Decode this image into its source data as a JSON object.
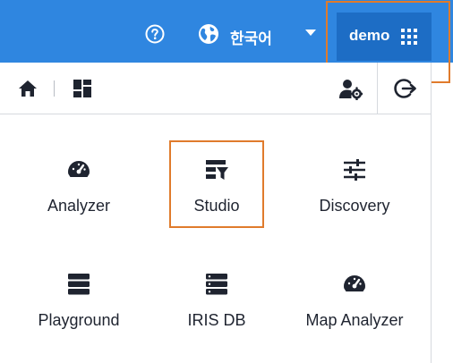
{
  "header": {
    "language_label": "한국어",
    "user_label": "demo",
    "help_icon": "question-circle-icon",
    "language_icon": "globe-icon",
    "apps_icon": "grid-apps-icon"
  },
  "toolbar": {
    "home_icon": "home-icon",
    "dashboard_icon": "dashboard-icon",
    "user_settings_icon": "user-cog-icon",
    "logout_icon": "logout-icon"
  },
  "apps": [
    {
      "label": "Analyzer",
      "icon": "speedometer-icon"
    },
    {
      "label": "Studio",
      "icon": "studio-filter-icon"
    },
    {
      "label": "Discovery",
      "icon": "sliders-icon"
    },
    {
      "label": "Playground",
      "icon": "stack-icon"
    },
    {
      "label": "IRIS DB",
      "icon": "server-icon"
    },
    {
      "label": "Map Analyzer",
      "icon": "speedometer-icon"
    }
  ],
  "colors": {
    "header_bg": "#2f86e0",
    "user_button_bg": "#1d6dc5",
    "highlight": "#e07b2c",
    "icon_dark": "#1f2430"
  }
}
